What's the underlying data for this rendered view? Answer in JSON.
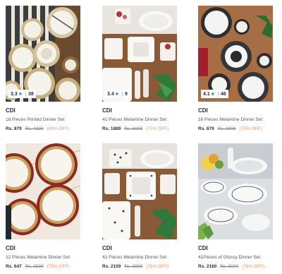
{
  "colors": {
    "price": "#282c3f",
    "discount": "#ff905a",
    "star_green": "#14958f",
    "star_teal": "#14958f"
  },
  "products": [
    {
      "brand": "CDI",
      "title": "18 Pieces Printed Dinner Set",
      "price": "Rs. 879",
      "mrp": "Rs. 4399",
      "discount": "(80% OFF)",
      "rating": "3.3",
      "rating_count": "38"
    },
    {
      "brand": "CDI",
      "title": "41 Pieces Melamine Dinner Set",
      "price": "Rs. 1889",
      "mrp": "Rs. 6999",
      "discount": "(73% OFF)",
      "rating": "3.4",
      "rating_count": "9"
    },
    {
      "brand": "CDI",
      "title": "16 Pieces Melamine Dinner Set",
      "price": "Rs. 879",
      "mrp": "Rs. 3999",
      "discount": "(78% OFF)",
      "rating": "4.1",
      "rating_count": "46"
    },
    {
      "brand": "CDI",
      "title": "12 Pieces Melamine Dinner Set",
      "price": "Rs. 647",
      "mrp": "Rs. 2599",
      "discount": "(75% OFF)"
    },
    {
      "brand": "CDI",
      "title": "41 Pieces Melamine Dinner Set",
      "price": "Rs. 2159",
      "mrp": "Rs. 8999",
      "discount": "(76% OFF)"
    },
    {
      "brand": "CDI",
      "title": "41Pieces of Glossy Dinner Set",
      "price": "Rs. 2160",
      "mrp": "Rs. 9000",
      "discount": "(76% OFF)"
    }
  ]
}
